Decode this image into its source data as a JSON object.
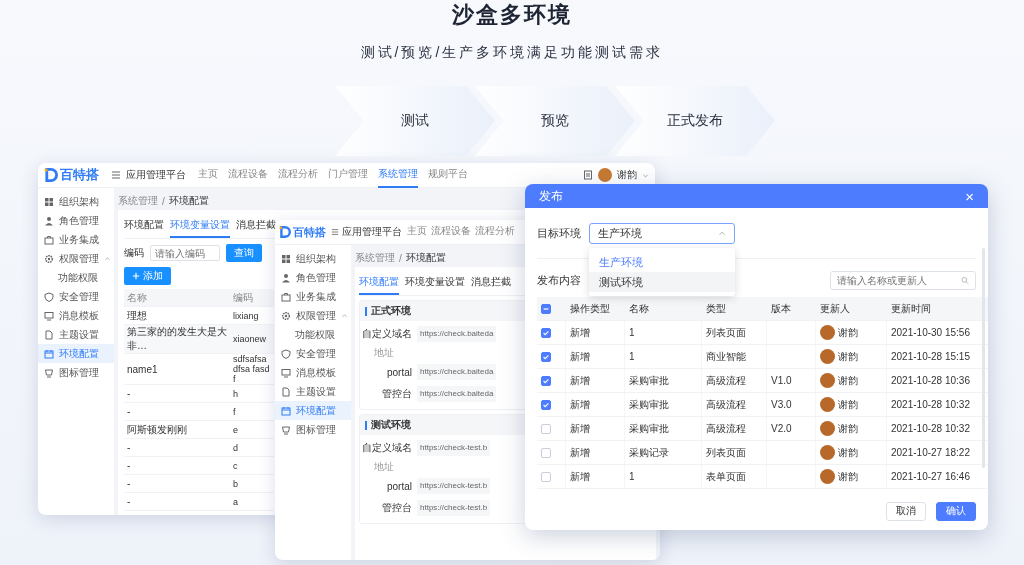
{
  "hero": {
    "title": "沙盒多环境",
    "subtitle": "测试/预览/生产多环境满足功能测试需求",
    "steps": [
      "测试",
      "预览",
      "正式发布"
    ]
  },
  "back_window": {
    "logo": "百特搭",
    "platform": "应用管理平台",
    "nav": [
      {
        "label": "主页",
        "selected": false
      },
      {
        "label": "流程设备",
        "selected": false
      },
      {
        "label": "流程分析",
        "selected": false
      },
      {
        "label": "门户管理",
        "selected": false
      },
      {
        "label": "系统管理",
        "selected": true
      },
      {
        "label": "规则平台",
        "selected": false
      }
    ],
    "user": "谢韵",
    "sidebar": [
      {
        "label": "组织架构",
        "selected": false
      },
      {
        "label": "角色管理",
        "selected": false
      },
      {
        "label": "业务集成",
        "selected": false
      },
      {
        "label": "权限管理",
        "selected": false,
        "expanded": true,
        "children": [
          {
            "label": "功能权限",
            "selected": false
          }
        ]
      },
      {
        "label": "安全管理",
        "selected": false
      },
      {
        "label": "消息模板",
        "selected": false
      },
      {
        "label": "主题设置",
        "selected": false
      },
      {
        "label": "环境配置",
        "selected": true
      },
      {
        "label": "图标管理",
        "selected": false
      }
    ],
    "breadcrumb": [
      "系统管理",
      "环境配置"
    ],
    "breadcrumb_separator": "/",
    "tabs": [
      {
        "label": "环境配置",
        "selected": false
      },
      {
        "label": "环境变量设置",
        "selected": true
      },
      {
        "label": "消息拦截",
        "selected": false
      }
    ],
    "filter": {
      "label": "编码",
      "placeholder": "请输入编码",
      "button": "查询"
    },
    "add_button": "添加",
    "table": {
      "columns": [
        "名称",
        "编码"
      ],
      "rows": [
        [
          "理想",
          "lixiang"
        ],
        [
          "第三家的的发生大是大非…",
          "xiaonew"
        ],
        [
          "name1",
          "sdfsafsadfsa fasdf"
        ],
        [
          "-",
          "h"
        ],
        [
          "-",
          "f"
        ],
        [
          "阿斯顿发刚刚",
          "e"
        ],
        [
          "-",
          "d"
        ],
        [
          "-",
          "c"
        ],
        [
          "-",
          "b"
        ],
        [
          "-",
          "a"
        ]
      ]
    }
  },
  "middle_window": {
    "logo": "百特搭",
    "platform": "应用管理平台",
    "nav": [
      {
        "label": "主页",
        "selected": false
      },
      {
        "label": "流程设备",
        "selected": false
      },
      {
        "label": "流程分析",
        "selected": false
      }
    ],
    "sidebar": [
      {
        "label": "组织架构",
        "selected": false
      },
      {
        "label": "角色管理",
        "selected": false
      },
      {
        "label": "业务集成",
        "selected": false
      },
      {
        "label": "权限管理",
        "selected": false,
        "expanded": true,
        "children": [
          {
            "label": "功能权限",
            "selected": false
          }
        ]
      },
      {
        "label": "安全管理",
        "selected": false
      },
      {
        "label": "消息模板",
        "selected": false
      },
      {
        "label": "主题设置",
        "selected": false
      },
      {
        "label": "环境配置",
        "selected": true
      },
      {
        "label": "图标管理",
        "selected": false
      }
    ],
    "breadcrumb": [
      "系统管理",
      "环境配置"
    ],
    "breadcrumb_separator": "/",
    "tabs": [
      {
        "label": "环境配置",
        "selected": true
      },
      {
        "label": "环境变量设置",
        "selected": false
      },
      {
        "label": "消息拦截",
        "selected": false
      }
    ],
    "sections": [
      {
        "title": "正式环境",
        "rows": [
          {
            "kind": "field",
            "label": "自定义域名",
            "value": "https://check.baiteda"
          },
          {
            "kind": "note",
            "label": "地址"
          },
          {
            "kind": "field",
            "label": "portal",
            "value": "https://check.baiteda"
          },
          {
            "kind": "field",
            "label": "管控台",
            "value": "https://check.baiteda"
          }
        ]
      },
      {
        "title": "测试环境",
        "rows": [
          {
            "kind": "field",
            "label": "自定义域名",
            "value": "https://check-test.b"
          },
          {
            "kind": "note",
            "label": "地址"
          },
          {
            "kind": "field",
            "label": "portal",
            "value": "https://check-test.b"
          },
          {
            "kind": "field",
            "label": "管控台",
            "value": "https://check-test.b"
          }
        ]
      }
    ]
  },
  "modal": {
    "title": "发布",
    "close": "×",
    "target": {
      "label": "目标环境",
      "value": "生产环境",
      "options": [
        {
          "label": "生产环境",
          "selected": true
        },
        {
          "label": "测试环境",
          "selected": false
        }
      ]
    },
    "content_label": "发布内容",
    "search": {
      "placeholder": "请输入名称或更新人"
    },
    "table": {
      "indeterminate": true,
      "columns": [
        "操作类型",
        "名称",
        "类型",
        "版本",
        "更新人",
        "更新时间"
      ],
      "rows": [
        {
          "checked": true,
          "cells": [
            "新增",
            "1",
            "列表页面",
            "",
            "谢韵",
            "2021-10-30 15:56"
          ]
        },
        {
          "checked": true,
          "cells": [
            "新增",
            "1",
            "商业智能",
            "",
            "谢韵",
            "2021-10-28 15:15"
          ]
        },
        {
          "checked": true,
          "cells": [
            "新增",
            "采购审批",
            "高级流程",
            "V1.0",
            "谢韵",
            "2021-10-28 10:36"
          ]
        },
        {
          "checked": true,
          "cells": [
            "新增",
            "采购审批",
            "高级流程",
            "V3.0",
            "谢韵",
            "2021-10-28 10:32"
          ]
        },
        {
          "checked": false,
          "cells": [
            "新增",
            "采购审批",
            "高级流程",
            "V2.0",
            "谢韵",
            "2021-10-28 10:32"
          ]
        },
        {
          "checked": false,
          "cells": [
            "新增",
            "采购记录",
            "列表页面",
            "",
            "谢韵",
            "2021-10-27 18:22"
          ]
        },
        {
          "checked": false,
          "cells": [
            "新增",
            "1",
            "表单页面",
            "",
            "谢韵",
            "2021-10-27 16:46"
          ]
        }
      ]
    },
    "buttons": [
      {
        "label": "取消",
        "kind": "secondary"
      },
      {
        "label": "确认",
        "kind": "primary"
      }
    ]
  }
}
